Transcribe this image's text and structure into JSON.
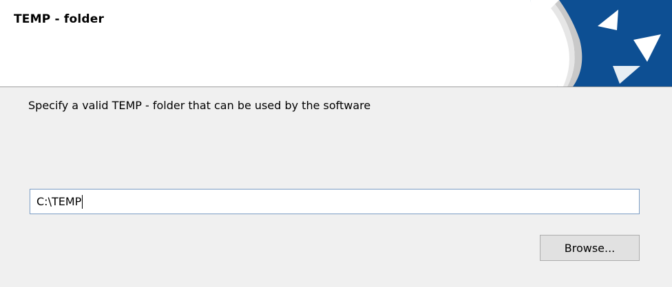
{
  "header": {
    "title": "TEMP - folder",
    "logo_icon": "curled-page-logo-icon",
    "logo_colors": {
      "blue": "#0d4f93",
      "page": "#ffffff"
    }
  },
  "main": {
    "instruction": "Specify a valid TEMP - folder that can be used by the software",
    "temp_folder_value": "C:\\TEMP",
    "browse_label": "Browse..."
  },
  "colors": {
    "panel_background": "#f0f0f0",
    "input_border": "#7a9cc4",
    "button_background": "#e1e1e1"
  }
}
